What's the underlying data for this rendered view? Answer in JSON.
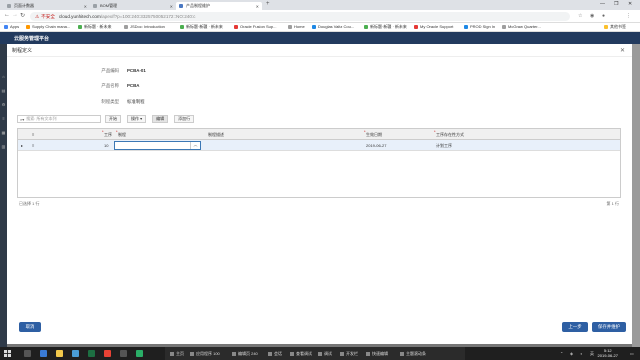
{
  "browser": {
    "tabs": [
      {
        "label": "页面计数器"
      },
      {
        "label": "BOM管理"
      },
      {
        "label": "产品制程维护"
      }
    ],
    "new_tab": "+",
    "controls": {
      "minimize": "—",
      "maximize": "❐",
      "close": "✕"
    },
    "insecure_label": "不安全",
    "url_host": "cloud.yunhitech.com",
    "url_rest": "/apex/f?p=100:240:3325750052172::NO:240:c"
  },
  "bookmarks": [
    {
      "label": "Apps",
      "color": "#4285f4"
    },
    {
      "label": "Supply Chain mana...",
      "color": "#ff9800"
    },
    {
      "label": "新标题 · 新未来",
      "color": "#4caf50"
    },
    {
      "label": "JSDoc: Introduction",
      "color": "#9e9e9e"
    },
    {
      "label": "新标题·新疆 · 新未来",
      "color": "#4caf50"
    },
    {
      "label": "Oracle Fusion Sup...",
      "color": "#e53935"
    },
    {
      "label": "Home",
      "color": "#9e9e9e"
    },
    {
      "label": "Douglas Valtz Cou...",
      "color": "#1e88e5"
    },
    {
      "label": "新标题·新疆 · 新未来",
      "color": "#4caf50"
    },
    {
      "label": "My Oracle Support",
      "color": "#e53935"
    },
    {
      "label": "PROD Sign In",
      "color": "#1e88e5"
    },
    {
      "label": "McGraw Quarter...",
      "color": "#9e9e9e"
    },
    {
      "label": "其他书签",
      "color": "#fbc02d"
    }
  ],
  "app": {
    "title": "云服务管理平台"
  },
  "dialog": {
    "title": "制程定义",
    "close": "✕",
    "fields": [
      {
        "label": "产品编码",
        "value": "PCBA-01"
      },
      {
        "label": "产品名称",
        "value": "PCBA"
      },
      {
        "label": "制程类型",
        "value": "标准制程"
      }
    ],
    "search_placeholder": "搜索: 所有文本列",
    "toolbar": {
      "go": "开始",
      "actions": "操作 ▾",
      "edit": "编辑",
      "add_row": "添加行"
    },
    "grid": {
      "headers": [
        "工序",
        "制程",
        "制程描述",
        "生效日期",
        "工序存在性方式"
      ],
      "rows": [
        {
          "seq": "10",
          "process": "",
          "desc": "",
          "date": "2019-06-27",
          "method": "计划工序"
        }
      ],
      "footer_left": "已选择 1 行",
      "footer_right": "第 1 行"
    },
    "buttons": {
      "cancel": "取消",
      "prev": "上一步",
      "save": "保存并维护"
    }
  },
  "taskbar": {
    "items": [
      {
        "label": "主页"
      },
      {
        "label": "应用程序 100"
      },
      {
        "label": "编辑页 240"
      },
      {
        "label": "会话"
      },
      {
        "label": "查看调试"
      },
      {
        "label": "调试"
      },
      {
        "label": "开发栏"
      },
      {
        "label": "快速编辑"
      },
      {
        "label": "主题滚动条"
      }
    ],
    "time": "5:12",
    "date": "2019-06-27",
    "lang": "英"
  }
}
